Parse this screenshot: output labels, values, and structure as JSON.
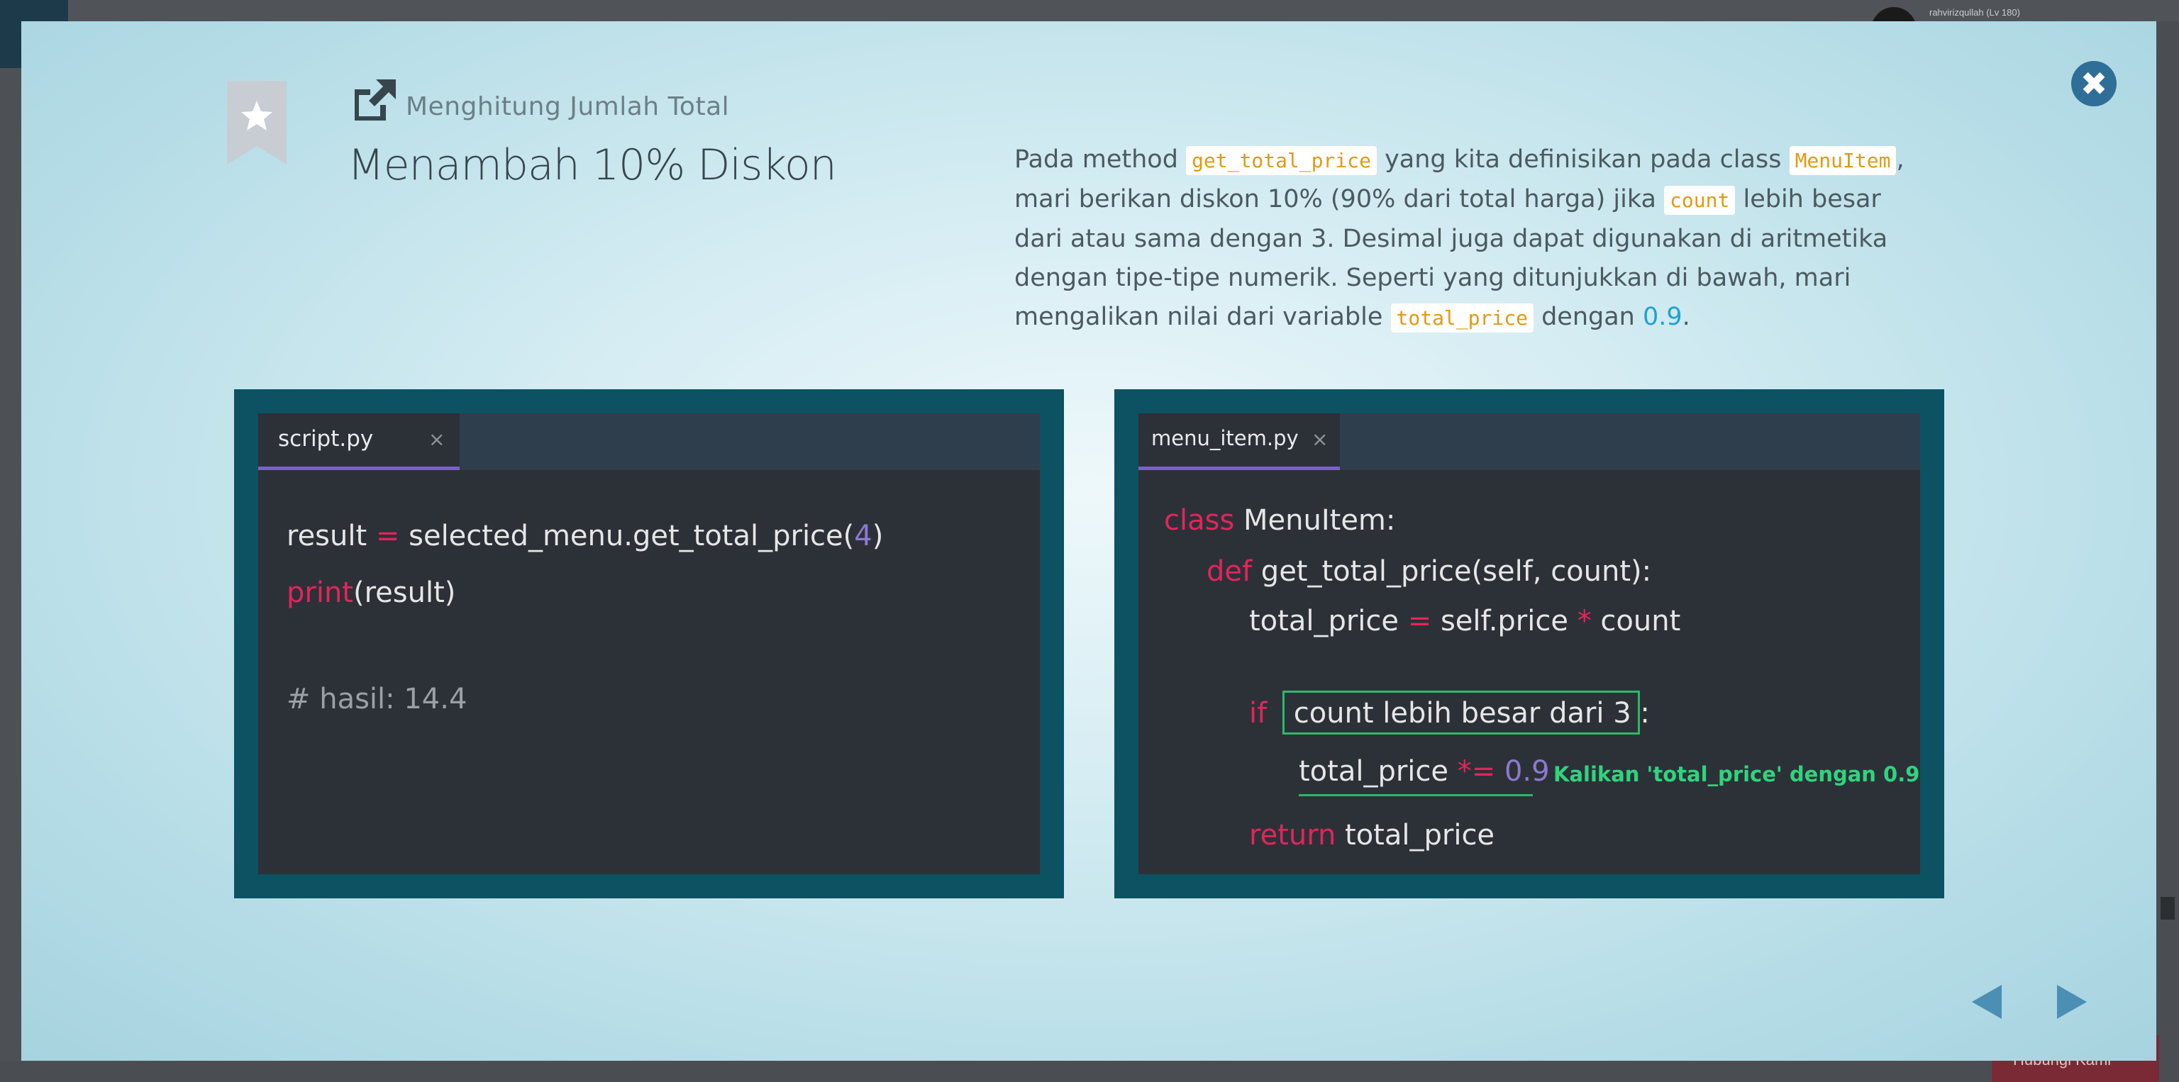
{
  "background": {
    "user_label": "rahvirizqullah (Lv 180)",
    "bottom_button_label": "Hubungi Kami"
  },
  "header": {
    "subtitle": "Menghitung Jumlah Total",
    "title": "Menambah 10% Diskon",
    "close_symbol": "✖"
  },
  "description": {
    "p1": "Pada method ",
    "c1": "get_total_price",
    "p2": " yang kita definisikan pada class ",
    "c2": "MenuItem",
    "p3": ", mari berikan diskon 10% (90% dari total harga) jika ",
    "c3": "count",
    "p4": " lebih besar dari atau sama dengan 3. Desimal juga dapat digunakan di aritmetika dengan tipe-tipe numerik. Seperti yang ditunjukkan di bawah, mari mengalikan nilai dari variable ",
    "c4": "total_price",
    "p5": " dengan ",
    "n1": "0.9",
    "p6": "."
  },
  "left_editor": {
    "tab_label": "script.py",
    "tab_close": "×",
    "line1": {
      "a": "result ",
      "b": "=",
      "c": " selected_menu.get_total_price(",
      "d": "4",
      "e": ")"
    },
    "line2": {
      "a": "print",
      "b": "(result)"
    },
    "comment": "# hasil: 14.4"
  },
  "right_editor": {
    "tab_label": "menu_item.py",
    "tab_close": "×",
    "l1": {
      "kw": "class",
      "rest": " MenuItem:"
    },
    "l2": {
      "kw": "def",
      "rest": " get_total_price(self, count):"
    },
    "l3": {
      "a": "total_price ",
      "b": "=",
      "c": " self.price ",
      "d": "*",
      "e": " count"
    },
    "l4": {
      "kw": "if",
      "box": " count lebih besar dari 3 : "
    },
    "l5": {
      "a": "total_price ",
      "b": "*=",
      "c": " ",
      "d": "0.9"
    },
    "annotation": "Kalikan 'total_price' dengan 0.9",
    "l6": {
      "kw": "return",
      "rest": " total_price"
    }
  },
  "colors": {
    "accent": "#2f6e97",
    "code_keyword": "#e2255b",
    "code_number": "#8b7ad1",
    "highlight": "#2bb86b",
    "panel_border": "#0c5262"
  }
}
